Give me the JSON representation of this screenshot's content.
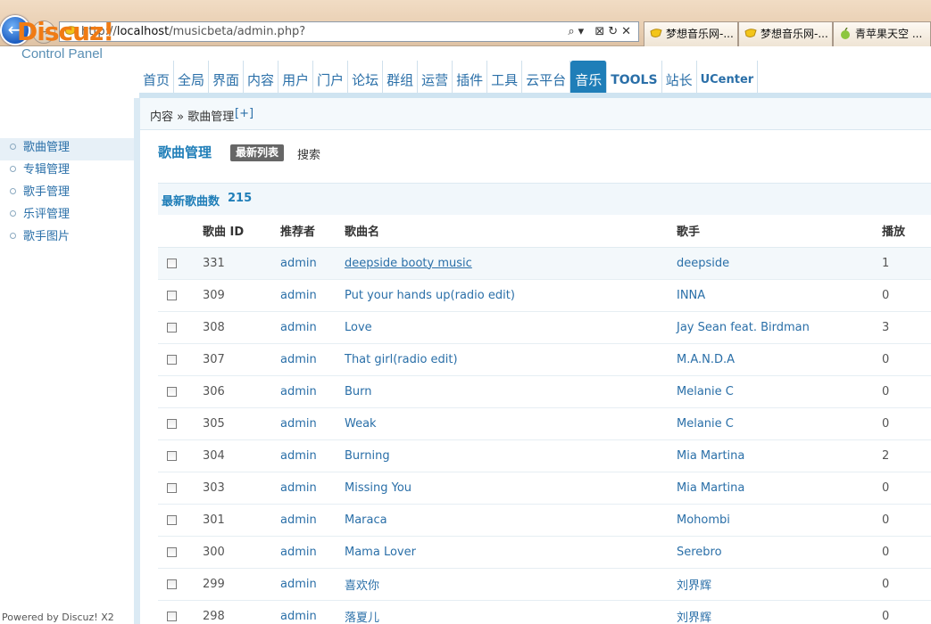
{
  "browser": {
    "url_prefix": "http://",
    "url_host": "localhost",
    "url_path": "/musicbeta/admin.php?",
    "url_tools": "⌕▾ ⊠↻✕",
    "tabs": [
      "梦想音乐网-...",
      "梦想音乐网-...",
      "青苹果天空 ..."
    ],
    "back_glyph": "←",
    "forward_glyph": "→"
  },
  "logo": {
    "main": "Discuz!",
    "sub": "Control Panel"
  },
  "topnav": [
    "首页",
    "全局",
    "界面",
    "内容",
    "用户",
    "门户",
    "论坛",
    "群组",
    "运营",
    "插件",
    "工具",
    "云平台",
    "音乐",
    "TOOLS",
    "站长",
    "UCenter"
  ],
  "topnav_active": "音乐",
  "breadcrumb": {
    "path": "内容 » 歌曲管理",
    "add": "[+]"
  },
  "sidebar": {
    "items": [
      "歌曲管理",
      "专辑管理",
      "歌手管理",
      "乐评管理",
      "歌手图片"
    ],
    "active": "歌曲管理",
    "powered": "Powered by Discuz! X2"
  },
  "main": {
    "title": "歌曲管理",
    "tab_active": "最新列表",
    "tab_search": "搜索",
    "count_label": "最新歌曲数",
    "count_value": "215"
  },
  "table": {
    "headers": [
      "",
      "歌曲 ID",
      "推荐者",
      "歌曲名",
      "歌手",
      "播放"
    ],
    "rows": [
      {
        "id": "331",
        "user": "admin",
        "song": "deepside booty music",
        "artist": "deepside",
        "plays": "1"
      },
      {
        "id": "309",
        "user": "admin",
        "song": "Put your hands up(radio edit)",
        "artist": "INNA",
        "plays": "0"
      },
      {
        "id": "308",
        "user": "admin",
        "song": "Love",
        "artist": "Jay Sean feat. Birdman",
        "plays": "3"
      },
      {
        "id": "307",
        "user": "admin",
        "song": "That girl(radio edit)",
        "artist": "M.A.N.D.A",
        "plays": "0"
      },
      {
        "id": "306",
        "user": "admin",
        "song": "Burn",
        "artist": "Melanie C",
        "plays": "0"
      },
      {
        "id": "305",
        "user": "admin",
        "song": "Weak",
        "artist": "Melanie C",
        "plays": "0"
      },
      {
        "id": "304",
        "user": "admin",
        "song": "Burning",
        "artist": "Mia Martina",
        "plays": "2"
      },
      {
        "id": "303",
        "user": "admin",
        "song": "Missing You",
        "artist": "Mia Martina",
        "plays": "0"
      },
      {
        "id": "301",
        "user": "admin",
        "song": "Maraca",
        "artist": "Mohombi",
        "plays": "0"
      },
      {
        "id": "300",
        "user": "admin",
        "song": "Mama Lover",
        "artist": "Serebro",
        "plays": "0"
      },
      {
        "id": "299",
        "user": "admin",
        "song": "喜欢你",
        "artist": "刘界辉",
        "plays": "0"
      },
      {
        "id": "298",
        "user": "admin",
        "song": "落夏儿",
        "artist": "刘界辉",
        "plays": "0"
      }
    ]
  },
  "colors": {
    "accent": "#1f7eb8",
    "logo": "#f07b14",
    "link": "#2a6fa8"
  }
}
